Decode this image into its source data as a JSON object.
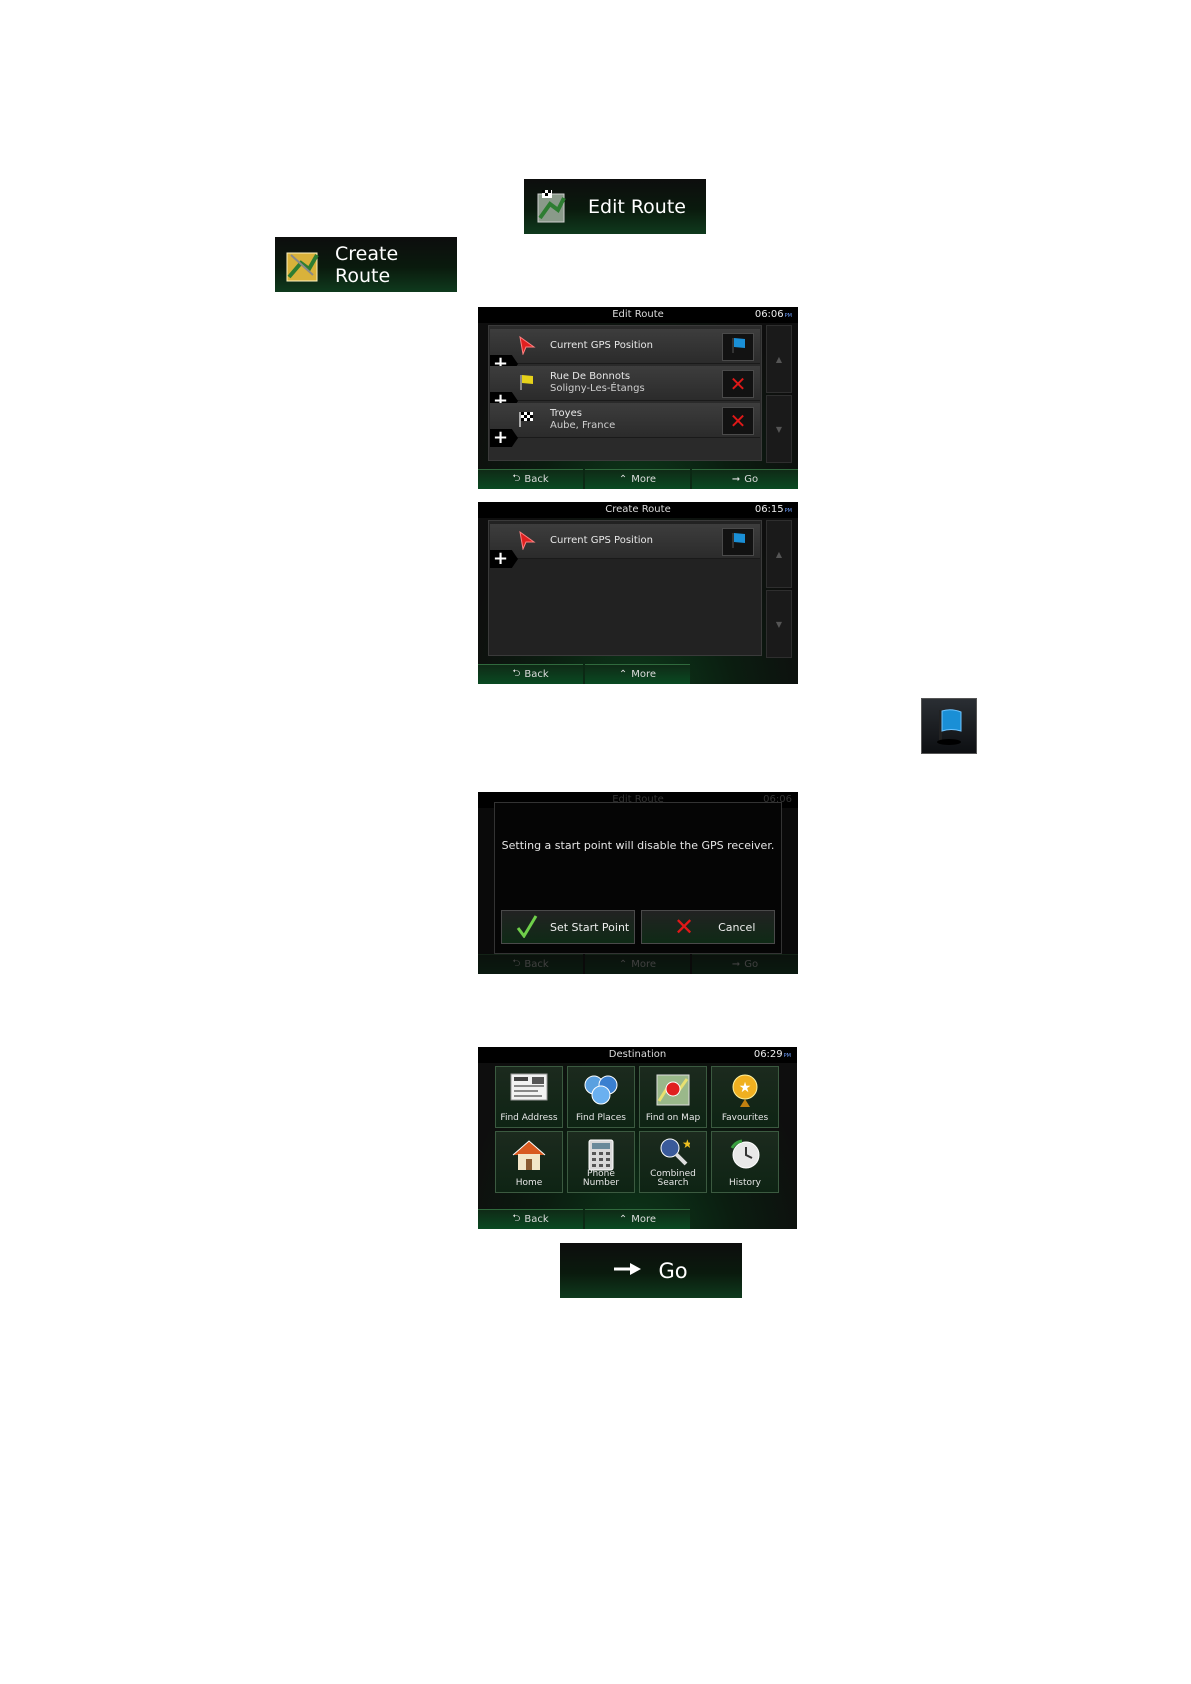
{
  "edit_route_button": {
    "label": "Edit Route"
  },
  "create_route_button": {
    "label": "Create Route"
  },
  "screen_edit_route": {
    "title": "Edit Route",
    "time": "06:06",
    "time_suffix": "PM",
    "rows": [
      {
        "line1": "Current GPS Position",
        "line2": ""
      },
      {
        "line1": "Rue De Bonnots",
        "line2": "Soligny-Les-Étangs"
      },
      {
        "line1": "Troyes",
        "line2": "Aube, France"
      }
    ],
    "bottom": {
      "back": "Back",
      "more": "More",
      "go": "Go"
    }
  },
  "screen_create_route": {
    "title": "Create Route",
    "time": "06:15",
    "time_suffix": "PM",
    "rows": [
      {
        "line1": "Current GPS Position"
      }
    ],
    "bottom": {
      "back": "Back",
      "more": "More"
    }
  },
  "screen_dialog": {
    "title": "Edit Route",
    "time": "06:06",
    "message": "Setting a start point will disable the GPS receiver.",
    "confirm": "Set Start Point",
    "cancel": "Cancel",
    "bottom": {
      "back": "Back",
      "more": "More",
      "go": "Go"
    }
  },
  "screen_destination": {
    "title": "Destination",
    "time": "06:29",
    "time_suffix": "PM",
    "tiles": [
      {
        "label": "Find Address"
      },
      {
        "label": "Find Places"
      },
      {
        "label": "Find on Map"
      },
      {
        "label": "Favourites"
      },
      {
        "label": "Home"
      },
      {
        "label": "Phone Number"
      },
      {
        "label": "Combined Search"
      },
      {
        "label": "History"
      }
    ],
    "bottom": {
      "back": "Back",
      "more": "More"
    }
  },
  "go_button": {
    "label": "Go"
  },
  "colors": {
    "accent_green": "#0f3a1d",
    "flag_blue": "#1a8fd6",
    "delete_red": "#e01818"
  }
}
